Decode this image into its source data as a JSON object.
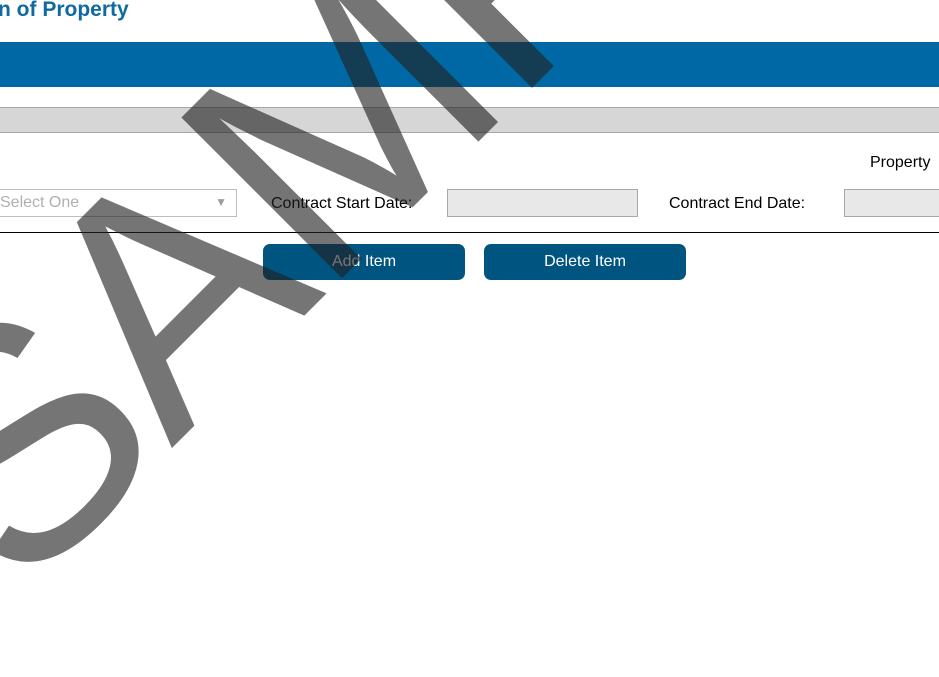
{
  "page": {
    "title": "n of Property"
  },
  "form": {
    "property_label": "Property",
    "property_type_select": {
      "selected": "Select One",
      "arrow_icon": "▼"
    },
    "contract_start_label": "Contract Start Date:",
    "contract_start_value": "",
    "contract_end_label": "Contract End Date:",
    "contract_end_value": ""
  },
  "actions": {
    "add_label": "Add Item",
    "delete_label": "Delete Item"
  },
  "watermark": {
    "text": "SAMPLE"
  },
  "colors": {
    "title": "#0f6aa2",
    "header_bar": "#0069a5",
    "button": "#005580",
    "watermark": "#202020"
  }
}
